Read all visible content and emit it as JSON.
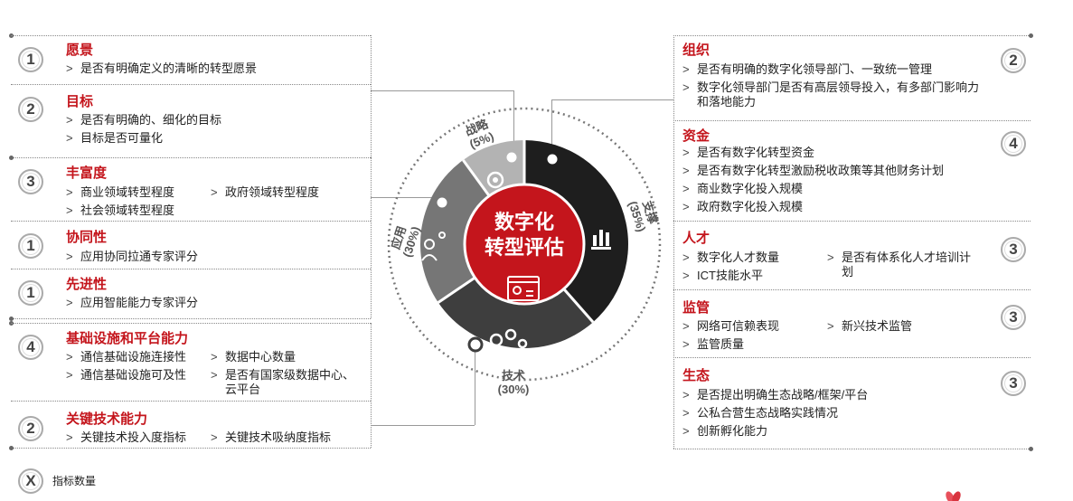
{
  "center": {
    "line1": "数字化",
    "line2": "转型评估"
  },
  "segments": {
    "strategy": {
      "name": "战略",
      "pct": "(5%)"
    },
    "support": {
      "name": "支撑",
      "pct": "(35%)"
    },
    "tech": {
      "name": "技术",
      "pct": "(30%)"
    },
    "apply": {
      "name": "应用",
      "pct": "(30%)"
    }
  },
  "left": {
    "vision": {
      "count": "1",
      "title": "愿景",
      "items": [
        "是否有明确定义的清晰的转型愿景"
      ]
    },
    "goal": {
      "count": "2",
      "title": "目标",
      "items": [
        "是否有明确的、细化的目标",
        "目标是否可量化"
      ]
    },
    "richness": {
      "count": "3",
      "title": "丰富度",
      "items": [
        "商业领域转型程度",
        "政府领域转型程度",
        "社会领域转型程度"
      ]
    },
    "synergy": {
      "count": "1",
      "title": "协同性",
      "items": [
        "应用协同拉通专家评分"
      ]
    },
    "advanced": {
      "count": "1",
      "title": "先进性",
      "items": [
        "应用智能能力专家评分"
      ]
    },
    "infra": {
      "count": "4",
      "title": "基础设施和平台能力",
      "items": [
        "通信基础设施连接性",
        "数据中心数量",
        "通信基础设施可及性",
        "是否有国家级数据中心、云平台"
      ]
    },
    "keytech": {
      "count": "2",
      "title": "关键技术能力",
      "items": [
        "关键技术投入度指标",
        "关键技术吸纳度指标"
      ]
    }
  },
  "right": {
    "org": {
      "count": "2",
      "title": "组织",
      "items": [
        "是否有明确的数字化领导部门、一致统一管理",
        "数字化领导部门是否有高层领导投入，有多部门影响力和落地能力"
      ]
    },
    "fund": {
      "count": "4",
      "title": "资金",
      "items": [
        "是否有数字化转型资金",
        "是否有数字化转型激励税收政策等其他财务计划",
        "商业数字化投入规模",
        "政府数字化投入规模"
      ]
    },
    "talent": {
      "count": "3",
      "title": "人才",
      "items": [
        "数字化人才数量",
        "是否有体系化人才培训计划",
        "ICT技能水平"
      ]
    },
    "regulation": {
      "count": "3",
      "title": "监管",
      "items": [
        "网络可信赖表现",
        "新兴技术监管",
        "监管质量"
      ]
    },
    "ecosystem": {
      "count": "3",
      "title": "生态",
      "items": [
        "是否提出明确生态战略/框架/平台",
        "公私合营生态战略实践情况",
        "创新孵化能力"
      ]
    }
  },
  "legend": {
    "symbol": "X",
    "label": "指标数量"
  },
  "colors": {
    "accent": "#c4151c",
    "support": "#1e1e1e",
    "tech": "#3e3e3e",
    "apply": "#767676",
    "strategy": "#b3b3b3"
  }
}
